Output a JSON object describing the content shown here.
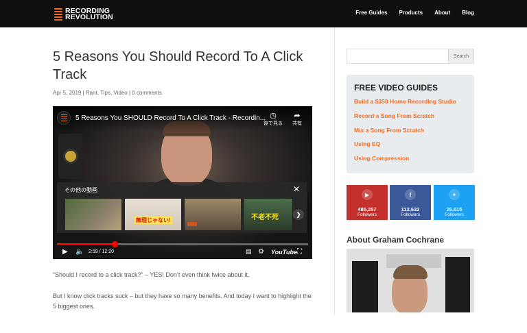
{
  "header": {
    "logo_line1": "RECORDING",
    "logo_line2": "REVOLUTION",
    "nav": [
      "Free Guides",
      "Products",
      "About",
      "Blog"
    ]
  },
  "article": {
    "title": "5 Reasons You Should Record To A Click Track",
    "date": "Apr 5, 2019",
    "categories": [
      "Rant",
      "Tips",
      "Video"
    ],
    "comments": "0 comments",
    "paragraph1": "“Should I record to a click track?” – YES! Don’t even think twice about it.",
    "paragraph2": "But I know click tracks suck – but they have so many benefits. And today I want to highlight the 5 biggest ones."
  },
  "video": {
    "title": "5 Reasons You SHOULD Record To A Click Track - Recordin...",
    "watch_later": "後で見る",
    "share": "共有",
    "more_videos": "その他の動画",
    "thumb2_text": "無理じゃない!",
    "thumb4_text": "不老不死",
    "time": "2:59 / 12:20",
    "progress": 0.23,
    "youtube_label": "YouTube"
  },
  "sidebar": {
    "search_button": "Search",
    "search_placeholder": "",
    "guides_title": "FREE VIDEO GUIDES",
    "guides": [
      "Build a $350 Home Recording Studio",
      "Record a Song From Scratch",
      "Mix a Song From Scratch",
      "Using EQ",
      "Using Compression"
    ],
    "social": [
      {
        "count": "485,257",
        "label": "Followers",
        "icon": "youtube-icon"
      },
      {
        "count": "112,632",
        "label": "Followers",
        "icon": "facebook-icon"
      },
      {
        "count": "26,015",
        "label": "Followers",
        "icon": "twitter-icon"
      }
    ],
    "about_title": "About Graham Cochrane"
  },
  "colors": {
    "accent": "#f26b21",
    "youtube": "#c4302b",
    "facebook": "#3b5998",
    "twitter": "#1da1f2"
  }
}
